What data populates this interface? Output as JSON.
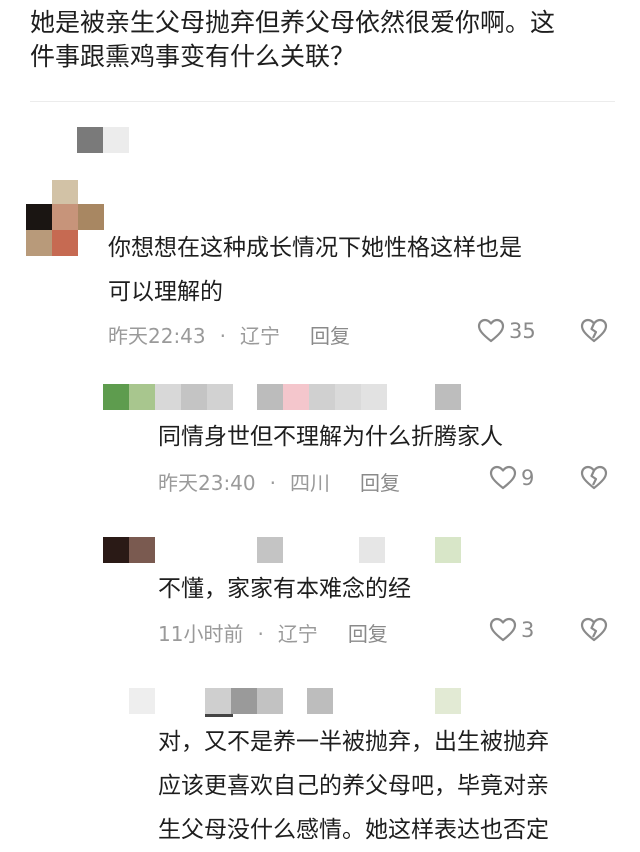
{
  "question": {
    "line1": "她是被亲生父母抛弃但养父母依然很爱你啊。这",
    "line2": "件事跟熏鸡事变有什么关联？"
  },
  "comments": [
    {
      "text_lines": [
        "你想想在这种成长情况下她性格这样也是",
        "可以理解的"
      ],
      "time": "昨天22:43",
      "location": "辽宁",
      "reply_label": "回复",
      "likes": "35"
    },
    {
      "text_lines": [
        "同情身世但不理解为什么折腾家人"
      ],
      "time": "昨天23:40",
      "location": "四川",
      "reply_label": "回复",
      "likes": "9"
    },
    {
      "text_lines": [
        "不懂，家家有本难念的经"
      ],
      "time": "11小时前",
      "location": "辽宁",
      "reply_label": "回复",
      "likes": "3"
    },
    {
      "text_lines": [
        "对，又不是养一半被抛弃，出生被抛弃",
        "应该更喜欢自己的养父母吧，毕竟对亲",
        "生父母没什么感情。她这样表达也否定"
      ]
    }
  ],
  "icons": {
    "like": "heart-outline-icon",
    "dislike": "broken-heart-icon"
  },
  "colors": {
    "text": "#1e1e1e",
    "meta": "#9a9a9a",
    "icon": "#8a8a8a"
  }
}
